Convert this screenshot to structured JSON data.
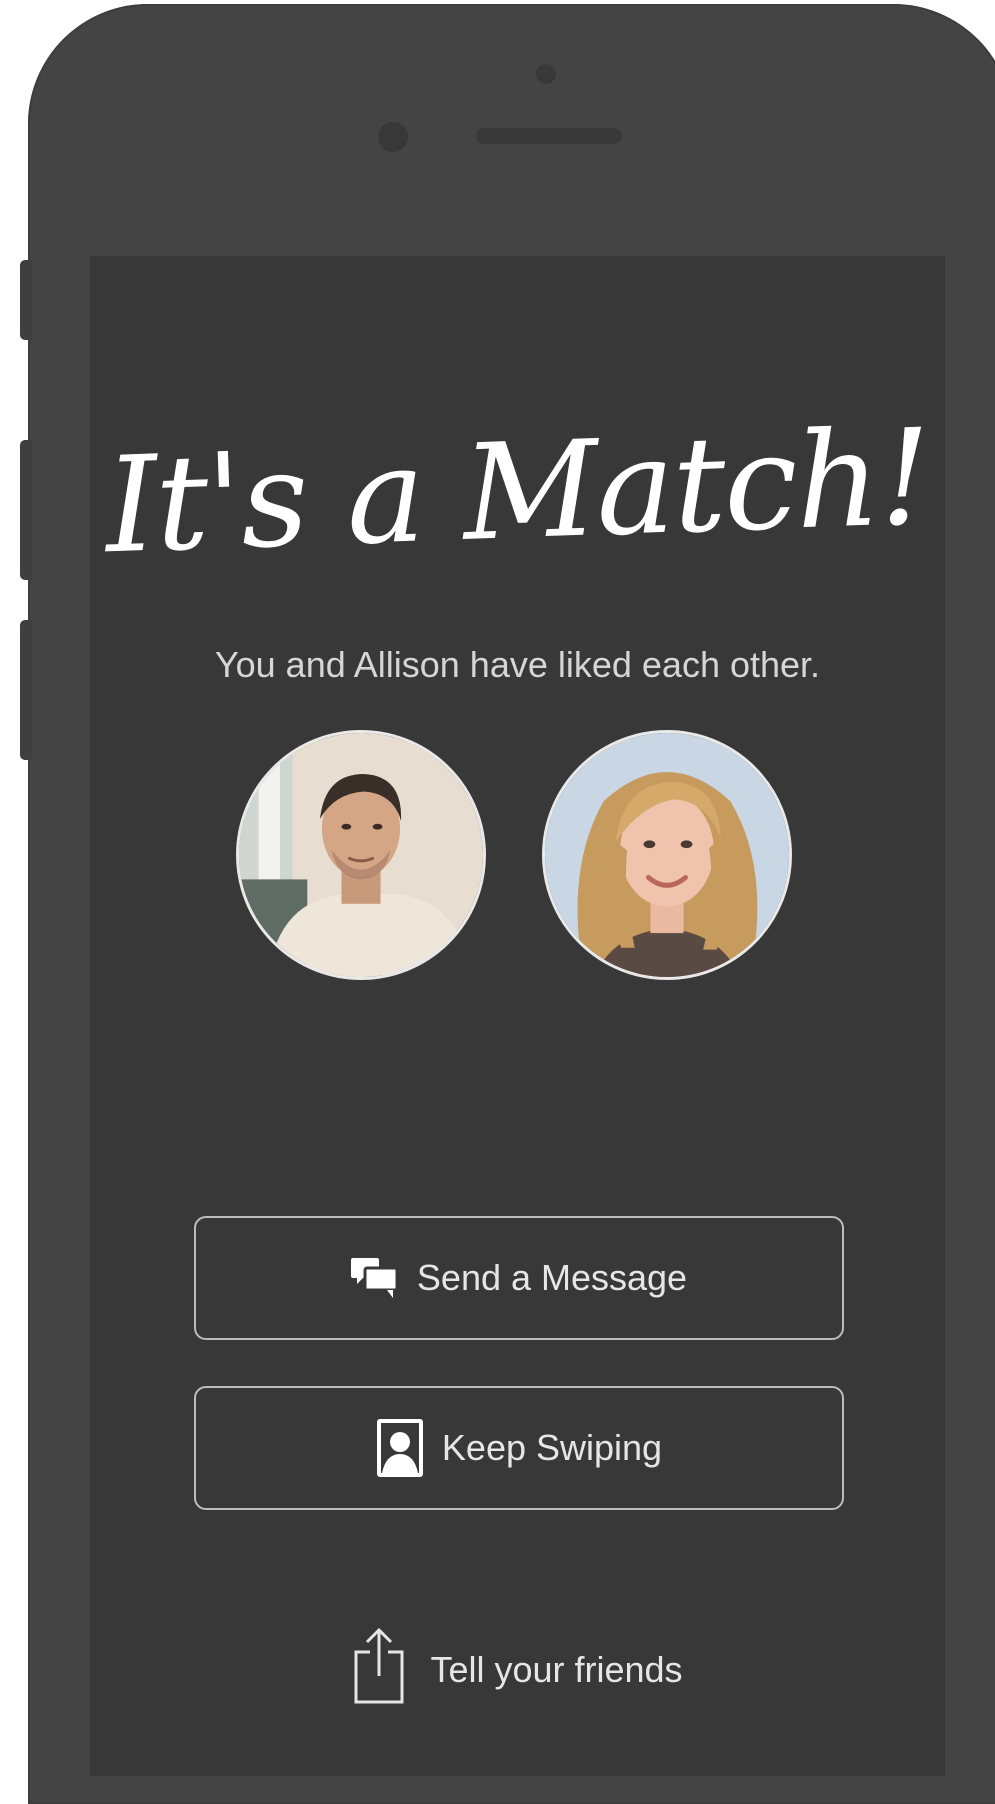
{
  "match": {
    "headline": "It's a Match!",
    "subtitle": "You and Allison have liked each other."
  },
  "avatars": {
    "me": "avatar-user",
    "match": "avatar-allison"
  },
  "actions": {
    "send_message_label": "Send a Message",
    "keep_swiping_label": "Keep Swiping",
    "tell_friends_label": "Tell your friends"
  },
  "icons": {
    "send_message": "chat-bubbles-icon",
    "keep_swiping": "person-card-icon",
    "tell_friends": "share-icon"
  },
  "colors": {
    "phone_body": "#444444",
    "screen_bg": "#383838",
    "text": "#ffffff",
    "button_border": "#bdbdbd"
  }
}
